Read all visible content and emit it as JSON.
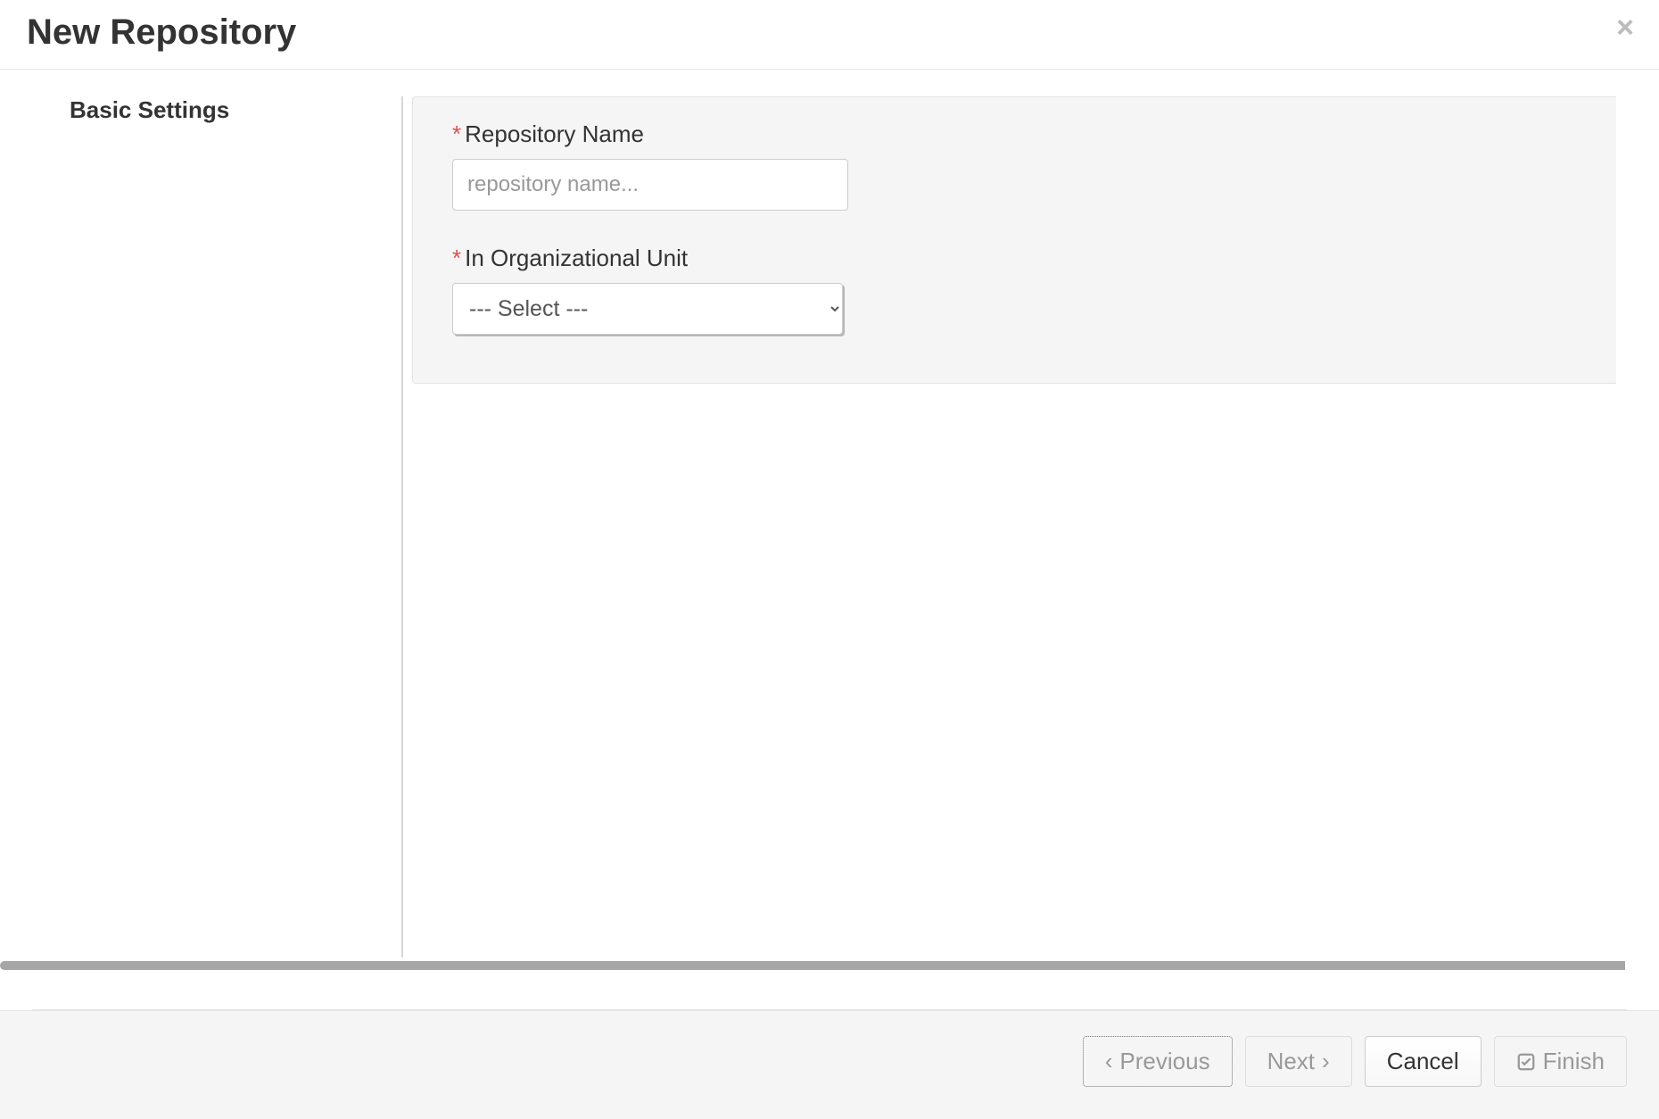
{
  "header": {
    "title": "New Repository"
  },
  "sidebar": {
    "items": [
      {
        "label": "Basic Settings"
      }
    ]
  },
  "form": {
    "repo_name": {
      "label": "Repository Name",
      "placeholder": "repository name...",
      "value": ""
    },
    "org_unit": {
      "label": "In Organizational Unit",
      "selected": "--- Select ---"
    }
  },
  "footer": {
    "previous": "Previous",
    "next": "Next",
    "cancel": "Cancel",
    "finish": "Finish"
  }
}
